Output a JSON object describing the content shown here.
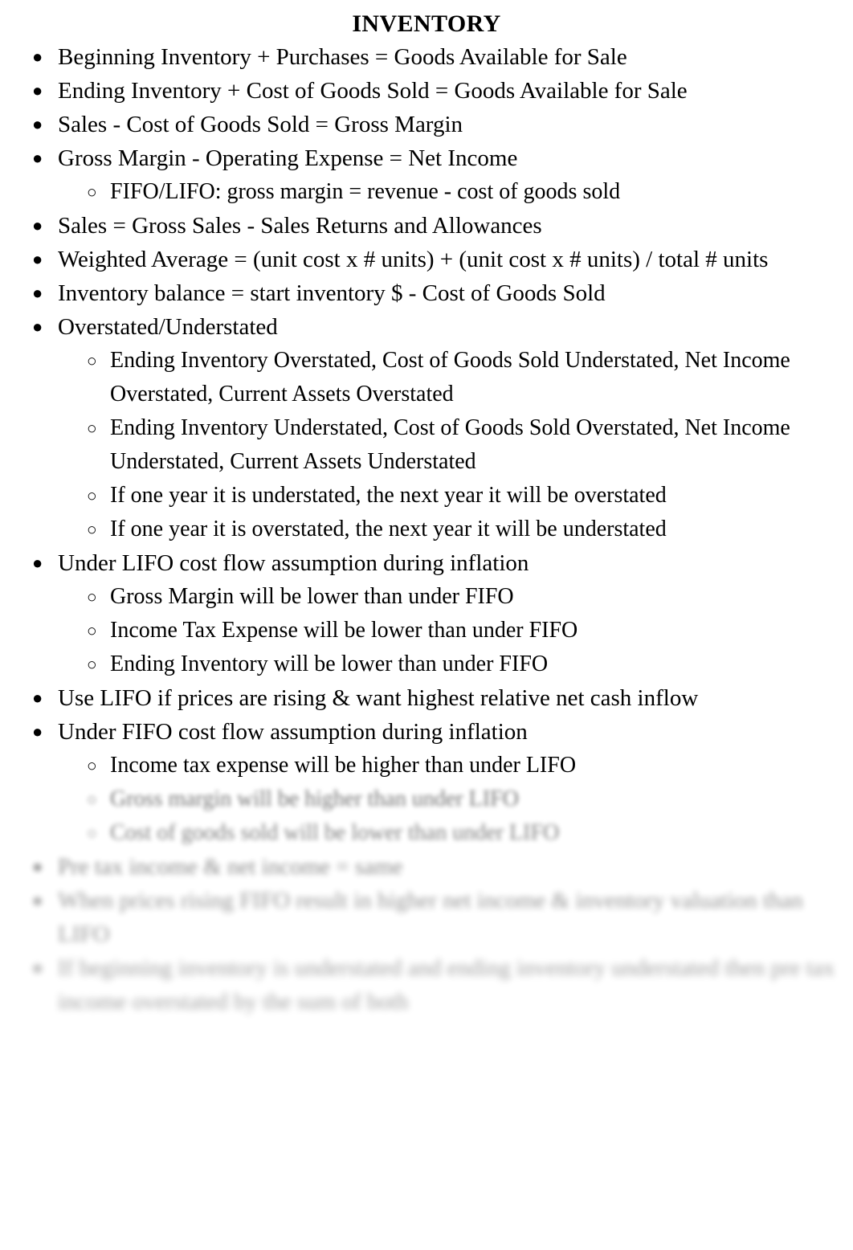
{
  "document": {
    "title": "INVENTORY",
    "bullet_glyphs": {
      "level1": "●",
      "level2": "○"
    },
    "ink_color": "#000000",
    "page_color": "#ffffff"
  },
  "outline": [
    {
      "level": 1,
      "text": "Beginning Inventory + Purchases = Goods Available for Sale",
      "blur": 0
    },
    {
      "level": 1,
      "text": "Ending Inventory + Cost of Goods Sold = Goods Available for Sale",
      "blur": 0
    },
    {
      "level": 1,
      "text": "Sales - Cost of Goods Sold = Gross Margin",
      "blur": 0
    },
    {
      "level": 1,
      "text": "Gross Margin - Operating Expense = Net Income",
      "blur": 0
    },
    {
      "level": 2,
      "text": "FIFO/LIFO: gross margin = revenue - cost of goods sold",
      "blur": 0
    },
    {
      "level": 1,
      "text": "Sales = Gross Sales - Sales Returns and Allowances",
      "blur": 0
    },
    {
      "level": 1,
      "text": "Weighted Average = (unit cost x # units) + (unit cost x # units) / total # units",
      "blur": 0
    },
    {
      "level": 1,
      "text": "Inventory balance = start inventory $ - Cost of Goods Sold",
      "blur": 0
    },
    {
      "level": 1,
      "text": "Overstated/Understated",
      "blur": 0
    },
    {
      "level": 2,
      "text": "Ending Inventory Overstated, Cost of Goods Sold Understated, Net Income Overstated, Current Assets Overstated",
      "blur": 0
    },
    {
      "level": 2,
      "text": "Ending Inventory Understated, Cost of Goods Sold Overstated, Net Income Understated, Current Assets Understated",
      "blur": 0
    },
    {
      "level": 2,
      "text": "If one year it is understated, the next year it will be overstated",
      "blur": 0
    },
    {
      "level": 2,
      "text": "If one year it is overstated, the next year it will be understated",
      "blur": 0
    },
    {
      "level": 1,
      "text": "Under LIFO cost flow assumption during inflation",
      "blur": 0
    },
    {
      "level": 2,
      "text": "Gross Margin will be lower than under FIFO",
      "blur": 0
    },
    {
      "level": 2,
      "text": "Income Tax Expense will be lower than under FIFO",
      "blur": 0
    },
    {
      "level": 2,
      "text": "Ending Inventory will be lower than under FIFO",
      "blur": 0
    },
    {
      "level": 1,
      "text": "Use LIFO if prices are rising & want highest relative net cash inflow",
      "blur": 0
    },
    {
      "level": 1,
      "text": "Under FIFO cost flow assumption during inflation",
      "blur": 0
    },
    {
      "level": 2,
      "text": "Income tax expense will be higher than under LIFO",
      "blur": 0
    },
    {
      "level": 2,
      "text": "Gross margin will be higher than under LIFO",
      "blur": 1
    },
    {
      "level": 2,
      "text": "Cost of goods sold will be lower than under LIFO",
      "blur": 2
    },
    {
      "level": 1,
      "text": "Pre tax income & net income = same",
      "blur": 3
    },
    {
      "level": 1,
      "text": "When prices rising FIFO result in higher net income & inventory valuation than LIFO",
      "blur": 4
    },
    {
      "level": 1,
      "text": "If beginning inventory is understated and ending inventory understated then pre tax income overstated by the sum of both",
      "blur": 5
    }
  ]
}
